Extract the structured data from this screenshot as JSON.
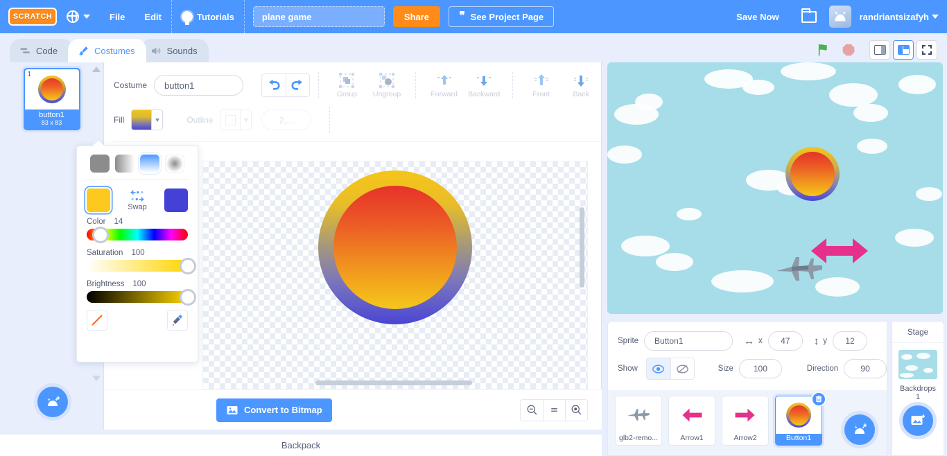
{
  "menubar": {
    "logo": "SCRATCH",
    "language_icon": "globe-icon",
    "file": "File",
    "edit": "Edit",
    "tutorials": "Tutorials",
    "project_title": "plane game",
    "project_title_placeholder": "Project title",
    "share": "Share",
    "see_project_page": "See Project Page",
    "save_now": "Save Now",
    "folder_icon": "folder-icon",
    "username": "randriantsizafyh"
  },
  "tabs": [
    {
      "label": "Code",
      "icon": "code-icon",
      "active": false
    },
    {
      "label": "Costumes",
      "icon": "paintbrush-icon",
      "active": true
    },
    {
      "label": "Sounds",
      "icon": "speaker-icon",
      "active": false
    }
  ],
  "stage_controls": {
    "green_flag": "green-flag-icon",
    "stop": "stop-icon",
    "small_stage": "small-stage-icon",
    "large_stage": "large-stage-icon",
    "fullscreen": "fullscreen-icon"
  },
  "costume_list": {
    "items": [
      {
        "index": "1",
        "name": "button1",
        "size": "83 x 83"
      }
    ],
    "add_button": "add-costume-button"
  },
  "paint_editor": {
    "costume_label": "Costume",
    "costume_name": "button1",
    "undo": "undo-icon",
    "redo": "redo-icon",
    "tools": [
      {
        "label": "Group",
        "icon": "group-icon"
      },
      {
        "label": "Ungroup",
        "icon": "ungroup-icon"
      },
      {
        "label": "Forward",
        "icon": "forward-icon"
      },
      {
        "label": "Backward",
        "icon": "backward-icon"
      },
      {
        "label": "Front",
        "icon": "front-icon"
      },
      {
        "label": "Back",
        "icon": "back-icon"
      }
    ],
    "fill_label": "Fill",
    "outline_label": "Outline",
    "stroke_width": "2,...",
    "convert_button": "Convert to Bitmap",
    "zoom_out": "zoom-out-icon",
    "zoom_reset": "zoom-reset-icon",
    "zoom_in": "zoom-in-icon"
  },
  "color_picker": {
    "gradient_types": [
      "solid-fill",
      "horizontal-gradient",
      "vertical-gradient",
      "radial-gradient"
    ],
    "selected_gradient": "vertical-gradient",
    "swap_label": "Swap",
    "color_a": "#fdc91f",
    "color_b": "#4341d6",
    "color_label": "Color",
    "color_value": "14",
    "saturation_label": "Saturation",
    "saturation_value": "100",
    "brightness_label": "Brightness",
    "brightness_value": "100",
    "no_fill_button": "no-fill-icon",
    "eyedropper_button": "eyedropper-icon"
  },
  "sprite_pane": {
    "sprite_label": "Sprite",
    "sprite_name": "Button1",
    "x_label": "x",
    "x_value": "47",
    "y_label": "y",
    "y_value": "12",
    "show_label": "Show",
    "show_on_icon": "eye-icon",
    "show_off_icon": "eye-slash-icon",
    "size_label": "Size",
    "size_value": "100",
    "direction_label": "Direction",
    "direction_value": "90"
  },
  "sprites": [
    {
      "name": "glb2-remo...",
      "icon": "plane-icon",
      "selected": false
    },
    {
      "name": "Arrow1",
      "icon": "arrow-left-icon",
      "selected": false
    },
    {
      "name": "Arrow2",
      "icon": "arrow-right-icon",
      "selected": false
    },
    {
      "name": "Button1",
      "icon": "button-icon",
      "selected": true
    }
  ],
  "add_sprite_button": "add-sprite-button",
  "stage_selector": {
    "title": "Stage",
    "backdrops_label": "Backdrops",
    "backdrops_count": "1",
    "add_backdrop_button": "add-backdrop-button"
  },
  "backpack": {
    "label": "Backpack"
  },
  "colors": {
    "brand_blue": "#4c97ff",
    "orange": "#ff8c1a",
    "text": "#575e75",
    "panel_bg": "#e8eefc",
    "stage_sky": "#a6dde8",
    "arrow_pink": "#e5318a"
  }
}
